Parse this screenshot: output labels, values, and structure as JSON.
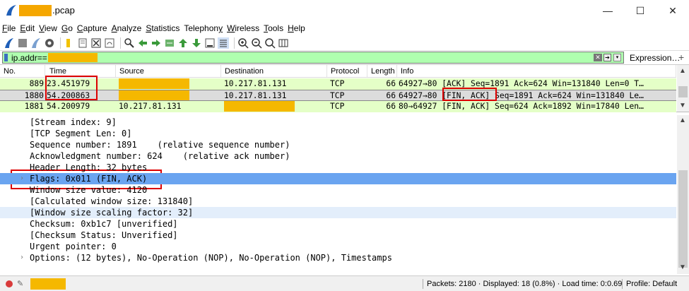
{
  "window": {
    "title_suffix": ".pcap",
    "minimize": "—",
    "maximize": "☐",
    "close": "✕"
  },
  "menu": [
    {
      "label": "File",
      "accel": "F",
      "rest": "ile"
    },
    {
      "label": "Edit",
      "accel": "E",
      "rest": "dit"
    },
    {
      "label": "View",
      "accel": "V",
      "rest": "iew"
    },
    {
      "label": "Go",
      "accel": "G",
      "rest": "o"
    },
    {
      "label": "Capture",
      "accel": "C",
      "rest": "apture"
    },
    {
      "label": "Analyze",
      "accel": "A",
      "rest": "nalyze"
    },
    {
      "label": "Statistics",
      "accel": "S",
      "rest": "tatistics"
    },
    {
      "label": "Telephony",
      "accel": "y",
      "pre": "Telephon",
      "rest": ""
    },
    {
      "label": "Wireless",
      "accel": "W",
      "rest": "ireless"
    },
    {
      "label": "Tools",
      "accel": "T",
      "rest": "ools"
    },
    {
      "label": "Help",
      "accel": "H",
      "rest": "elp"
    }
  ],
  "filter": {
    "text": "ip.addr==",
    "expression_label": "Expression…",
    "add_label": "+",
    "clear_glyph": "✕",
    "apply_glyph": "➔",
    "drop_glyph": "▾"
  },
  "packet_list": {
    "columns": [
      "No.",
      "Time",
      "Source",
      "Destination",
      "Protocol",
      "Length",
      "Info"
    ],
    "rows": [
      {
        "no": "889",
        "time": "23.451979",
        "source": "",
        "destination": "10.217.81.131",
        "protocol": "TCP",
        "length": "66",
        "info_pre": "64927→80 [ACK] Seq=1891 Ack=624 Win=131840 Len=0 T…",
        "info_flag": "",
        "info_post": ""
      },
      {
        "no": "1880",
        "time": "54.200863",
        "source": "",
        "destination": "10.217.81.131",
        "protocol": "TCP",
        "length": "66",
        "info_pre": "64927→80 ",
        "info_flag": "[FIN, ACK]",
        "info_post": " Seq=1891 Ack=624 Win=131840 Le…"
      },
      {
        "no": "1881",
        "time": "54.200979",
        "source": "10.217.81.131",
        "destination": "",
        "protocol": "TCP",
        "length": "66",
        "info_pre": "80→64927 [FIN, ACK] Seq=624 Ack=1892 Win=17840 Len…",
        "info_flag": "",
        "info_post": ""
      }
    ]
  },
  "details": [
    {
      "text": "[Stream index: 9]",
      "arrow": "",
      "state": ""
    },
    {
      "text": "[TCP Segment Len: 0]",
      "arrow": "",
      "state": ""
    },
    {
      "text": "Sequence number: 1891    (relative sequence number)",
      "arrow": "",
      "state": ""
    },
    {
      "text": "Acknowledgment number: 624    (relative ack number)",
      "arrow": "",
      "state": ""
    },
    {
      "text": "Header Length: 32 bytes",
      "arrow": "",
      "state": ""
    },
    {
      "text": "Flags: 0x011 (FIN, ACK)",
      "arrow": "›",
      "state": "sel"
    },
    {
      "text": "Window size value: 4120",
      "arrow": "",
      "state": ""
    },
    {
      "text": "[Calculated window size: 131840]",
      "arrow": "",
      "state": ""
    },
    {
      "text": "[Window size scaling factor: 32]",
      "arrow": "",
      "state": "hl"
    },
    {
      "text": "Checksum: 0xb1c7 [unverified]",
      "arrow": "",
      "state": ""
    },
    {
      "text": "[Checksum Status: Unverified]",
      "arrow": "",
      "state": ""
    },
    {
      "text": "Urgent pointer: 0",
      "arrow": "",
      "state": ""
    },
    {
      "text": "Options: (12 bytes), No-Operation (NOP), No-Operation (NOP), Timestamps",
      "arrow": "›",
      "state": ""
    }
  ],
  "status": {
    "packets": "Packets: 2180 · Displayed: 18 (0.8%) · Load time: 0:0.69",
    "profile": "Profile: Default"
  },
  "colors": {
    "accent": "#6aa4f0",
    "redaction": "#f5b800",
    "filter_ok": "#afffaf",
    "row_green": "#e4ffc7",
    "highlight_box": "#dd0000"
  }
}
